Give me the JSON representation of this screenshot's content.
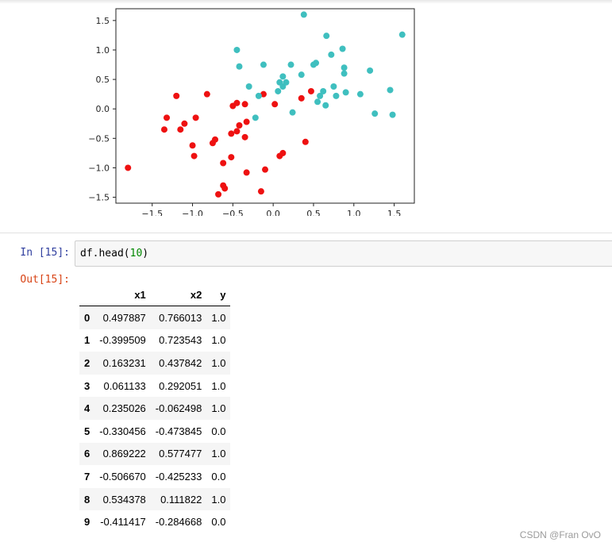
{
  "notebook": {
    "input_prompt": "In  [15]:",
    "output_prompt": "Out[15]:",
    "code": {
      "text": "df.head(",
      "arg": "10",
      "close": ")"
    }
  },
  "chart_data": {
    "type": "scatter",
    "title": "",
    "xlabel": "",
    "ylabel": "",
    "xlim": [
      -1.95,
      1.75
    ],
    "ylim": [
      -1.6,
      1.7
    ],
    "xticks": [
      "−1.5",
      "−1.0",
      "−0.5",
      "0.0",
      "0.5",
      "1.0",
      "1.5"
    ],
    "yticks": [
      "−1.5",
      "−1.0",
      "−0.5",
      "0.0",
      "0.5",
      "1.0",
      "1.5"
    ],
    "grid": false,
    "colors": {
      "class_0": "#ee1111",
      "class_1": "#3fbfbf"
    },
    "series": [
      {
        "points": [
          [
            -1.8,
            -1.0
          ],
          [
            -1.35,
            -0.35
          ],
          [
            -1.32,
            -0.15
          ],
          [
            -1.2,
            0.22
          ],
          [
            -1.15,
            -0.35
          ],
          [
            -1.1,
            -0.25
          ],
          [
            -1.0,
            -0.62
          ],
          [
            -0.98,
            -0.8
          ],
          [
            -0.96,
            -0.15
          ],
          [
            -0.82,
            0.25
          ],
          [
            -0.75,
            -0.58
          ],
          [
            -0.72,
            -0.52
          ],
          [
            -0.68,
            -1.45
          ],
          [
            -0.62,
            -1.3
          ],
          [
            -0.62,
            -0.92
          ],
          [
            -0.6,
            -1.35
          ],
          [
            -0.52,
            -0.42
          ],
          [
            -0.52,
            -0.82
          ],
          [
            -0.5,
            0.05
          ],
          [
            -0.45,
            0.1
          ],
          [
            -0.45,
            -0.38
          ],
          [
            -0.42,
            -0.28
          ],
          [
            -0.35,
            0.08
          ],
          [
            -0.35,
            -0.48
          ],
          [
            -0.33,
            -0.22
          ],
          [
            -0.33,
            -1.08
          ],
          [
            -0.15,
            -1.4
          ],
          [
            -0.12,
            0.25
          ],
          [
            -0.1,
            -1.03
          ],
          [
            0.02,
            0.08
          ],
          [
            0.08,
            -0.8
          ],
          [
            0.12,
            -0.75
          ],
          [
            0.35,
            0.18
          ],
          [
            0.4,
            -0.56
          ],
          [
            0.47,
            0.3
          ]
        ]
      },
      {
        "points": [
          [
            -0.45,
            1.0
          ],
          [
            -0.42,
            0.72
          ],
          [
            -0.3,
            0.38
          ],
          [
            -0.22,
            -0.15
          ],
          [
            -0.18,
            0.22
          ],
          [
            -0.12,
            0.75
          ],
          [
            0.06,
            0.3
          ],
          [
            0.08,
            0.45
          ],
          [
            0.12,
            0.38
          ],
          [
            0.12,
            0.55
          ],
          [
            0.16,
            0.45
          ],
          [
            0.22,
            0.75
          ],
          [
            0.24,
            -0.06
          ],
          [
            0.35,
            0.58
          ],
          [
            0.38,
            1.6
          ],
          [
            0.5,
            0.75
          ],
          [
            0.53,
            0.78
          ],
          [
            0.55,
            0.12
          ],
          [
            0.58,
            0.22
          ],
          [
            0.62,
            0.3
          ],
          [
            0.65,
            0.06
          ],
          [
            0.66,
            1.24
          ],
          [
            0.72,
            0.92
          ],
          [
            0.75,
            0.38
          ],
          [
            0.78,
            0.22
          ],
          [
            0.86,
            1.02
          ],
          [
            0.88,
            0.6
          ],
          [
            0.88,
            0.7
          ],
          [
            0.9,
            0.28
          ],
          [
            1.08,
            0.25
          ],
          [
            1.2,
            0.65
          ],
          [
            1.26,
            -0.08
          ],
          [
            1.45,
            0.32
          ],
          [
            1.48,
            -0.1
          ],
          [
            1.6,
            1.26
          ]
        ]
      }
    ]
  },
  "table": {
    "columns": [
      "",
      "x1",
      "x2",
      "y"
    ],
    "rows": [
      {
        "index": "0",
        "x1": "0.497887",
        "x2": "0.766013",
        "y": "1.0"
      },
      {
        "index": "1",
        "x1": "-0.399509",
        "x2": "0.723543",
        "y": "1.0"
      },
      {
        "index": "2",
        "x1": "0.163231",
        "x2": "0.437842",
        "y": "1.0"
      },
      {
        "index": "3",
        "x1": "0.061133",
        "x2": "0.292051",
        "y": "1.0"
      },
      {
        "index": "4",
        "x1": "0.235026",
        "x2": "-0.062498",
        "y": "1.0"
      },
      {
        "index": "5",
        "x1": "-0.330456",
        "x2": "-0.473845",
        "y": "0.0"
      },
      {
        "index": "6",
        "x1": "0.869222",
        "x2": "0.577477",
        "y": "1.0"
      },
      {
        "index": "7",
        "x1": "-0.506670",
        "x2": "-0.425233",
        "y": "0.0"
      },
      {
        "index": "8",
        "x1": "0.534378",
        "x2": "0.111822",
        "y": "1.0"
      },
      {
        "index": "9",
        "x1": "-0.411417",
        "x2": "-0.284668",
        "y": "0.0"
      }
    ]
  },
  "watermark": "CSDN @Fran OvO"
}
